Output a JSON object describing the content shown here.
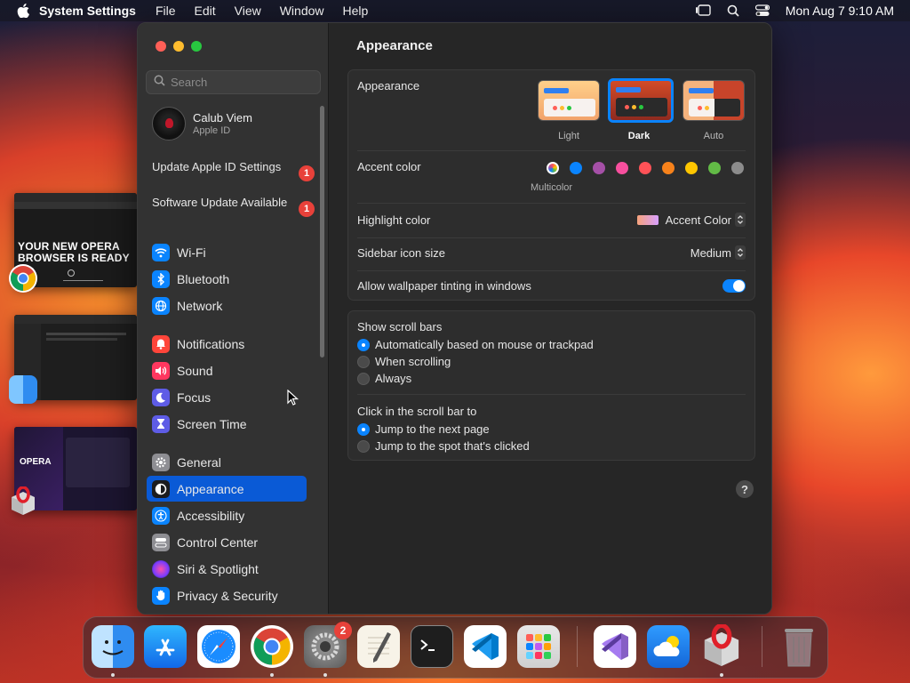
{
  "menubar": {
    "app_name": "System Settings",
    "items": [
      "File",
      "Edit",
      "View",
      "Window",
      "Help"
    ],
    "clock": "Mon Aug 7  9:10 AM"
  },
  "sidebar": {
    "search_placeholder": "Search",
    "account": {
      "name": "Calub Viem",
      "sub": "Apple ID"
    },
    "notices": [
      {
        "label": "Update Apple ID Settings",
        "badge": "1"
      },
      {
        "label": "Software Update Available",
        "badge": "1"
      }
    ],
    "items": [
      {
        "label": "Wi-Fi",
        "icon": "wifi-icon",
        "color": "#0a84ff"
      },
      {
        "label": "Bluetooth",
        "icon": "bluetooth-icon",
        "color": "#0a84ff"
      },
      {
        "label": "Network",
        "icon": "globe-icon",
        "color": "#0a84ff"
      },
      {
        "label": "Notifications",
        "icon": "bell-icon",
        "color": "#ff453a"
      },
      {
        "label": "Sound",
        "icon": "speaker-icon",
        "color": "#ff375f"
      },
      {
        "label": "Focus",
        "icon": "moon-icon",
        "color": "#5e5ce6"
      },
      {
        "label": "Screen Time",
        "icon": "hourglass-icon",
        "color": "#5e5ce6"
      },
      {
        "label": "General",
        "icon": "gear-icon",
        "color": "#8e8e93"
      },
      {
        "label": "Appearance",
        "icon": "appearance-icon",
        "color": "#1c1c1e",
        "selected": true
      },
      {
        "label": "Accessibility",
        "icon": "accessibility-icon",
        "color": "#0a84ff"
      },
      {
        "label": "Control Center",
        "icon": "control-center-icon",
        "color": "#8e8e93"
      },
      {
        "label": "Siri & Spotlight",
        "icon": "siri-icon",
        "color": "#bf5af2"
      },
      {
        "label": "Privacy & Security",
        "icon": "hand-icon",
        "color": "#0a84ff"
      }
    ]
  },
  "main": {
    "title": "Appearance",
    "appearance": {
      "label": "Appearance",
      "options": [
        {
          "label": "Light",
          "selected": false
        },
        {
          "label": "Dark",
          "selected": true
        },
        {
          "label": "Auto",
          "selected": false
        }
      ]
    },
    "accent": {
      "label": "Accent color",
      "selected_label": "Multicolor",
      "colors": [
        "#multicolor",
        "#0a84ff",
        "#a550a7",
        "#f74f9e",
        "#ff5257",
        "#f7821b",
        "#ffc600",
        "#62ba46",
        "#8c8c8c"
      ]
    },
    "highlight": {
      "label": "Highlight color",
      "value": "Accent Color"
    },
    "icon_size": {
      "label": "Sidebar icon size",
      "value": "Medium"
    },
    "tinting": {
      "label": "Allow wallpaper tinting in windows",
      "enabled": true
    },
    "scroll_bars": {
      "label": "Show scroll bars",
      "options": [
        {
          "label": "Automatically based on mouse or trackpad",
          "selected": true
        },
        {
          "label": "When scrolling",
          "selected": false
        },
        {
          "label": "Always",
          "selected": false
        }
      ]
    },
    "click_scroll": {
      "label": "Click in the scroll bar to",
      "options": [
        {
          "label": "Jump to the next page",
          "selected": true
        },
        {
          "label": "Jump to the spot that's clicked",
          "selected": false
        }
      ]
    },
    "help": "?"
  },
  "desktop": {
    "opera_promo": "YOUR NEW OPERA BROWSER IS READY",
    "opera_label": "OPERA"
  },
  "dock": {
    "settings_badge": "2",
    "apps": [
      "finder-icon",
      "app-store-icon",
      "safari-icon",
      "chrome-icon",
      "system-settings-icon",
      "textedit-icon",
      "terminal-icon",
      "vscode-icon",
      "launchpad-icon",
      "visual-studio-icon",
      "weather-icon",
      "opera-installer-icon",
      "trash-icon"
    ]
  }
}
